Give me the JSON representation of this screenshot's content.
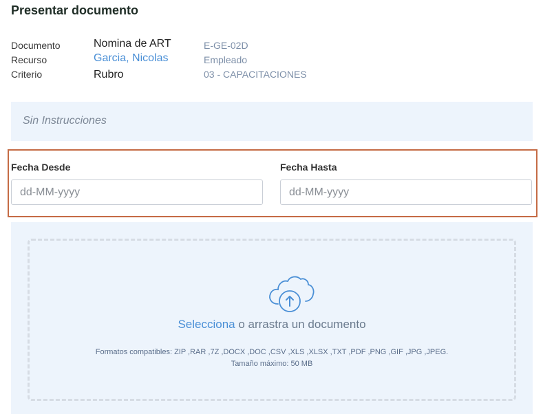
{
  "page_title": "Presentar documento",
  "meta": {
    "documento": {
      "label": "Documento",
      "value": "Nomina de ART",
      "code": "E-GE-02D"
    },
    "recurso": {
      "label": "Recurso",
      "value": "Garcia, Nicolas",
      "code": "Empleado"
    },
    "criterio": {
      "label": "Criterio",
      "value": "Rubro",
      "code": "03 - CAPACITACIONES"
    }
  },
  "instructions": "Sin Instrucciones",
  "dates": {
    "desde": {
      "label": "Fecha Desde",
      "placeholder": "dd-MM-yyyy"
    },
    "hasta": {
      "label": "Fecha Hasta",
      "placeholder": "dd-MM-yyyy"
    }
  },
  "upload": {
    "icon": "cloud-upload-icon",
    "select_link": "Selecciona",
    "drop_text": " o arrastra un documento",
    "formats": "Formatos compatibles: ZIP ,RAR ,7Z ,DOCX ,DOC ,CSV ,XLS ,XLSX ,TXT ,PDF ,PNG ,GIF ,JPG ,JPEG.",
    "max_size": "Tamaño máximo: 50 MB"
  },
  "colors": {
    "link": "#4a8fd6",
    "panel_bg": "#edf4fc",
    "highlight_border": "#c56b45",
    "code_text": "#7d8fa8"
  }
}
